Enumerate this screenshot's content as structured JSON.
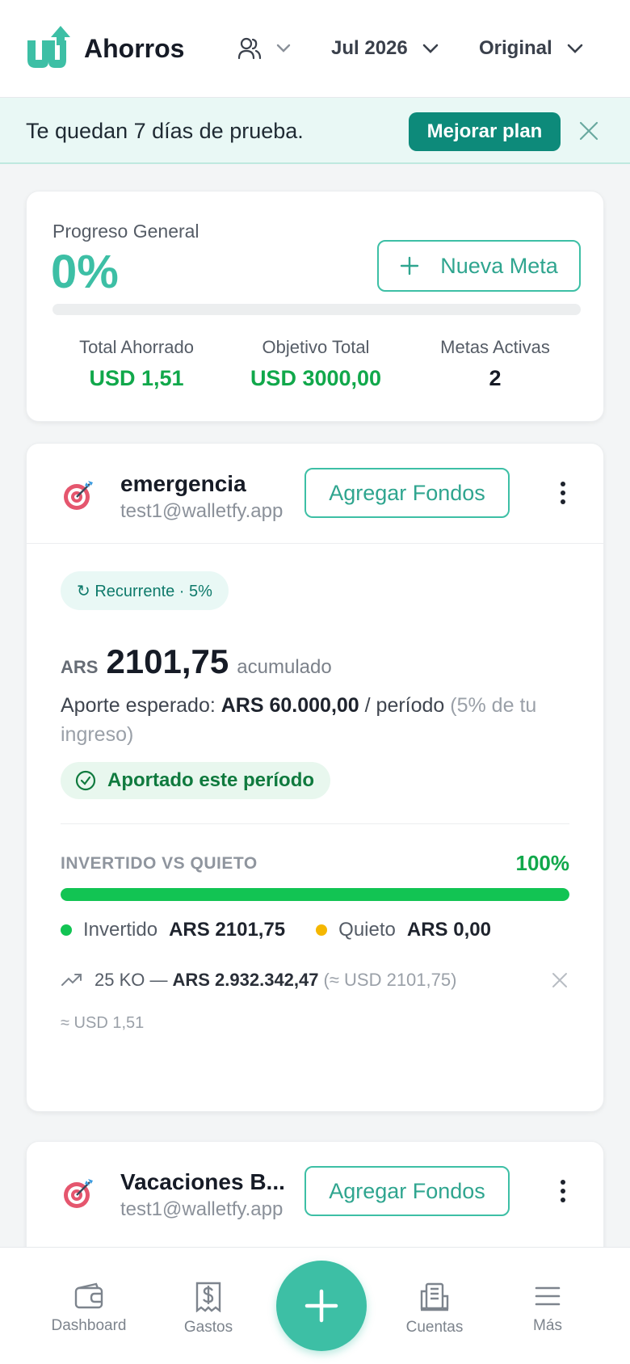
{
  "header": {
    "brand": "Ahorros",
    "month": "Jul 2026",
    "currency_mode": "Original"
  },
  "banner": {
    "text": "Te quedan 7 días de prueba.",
    "button": "Mejorar plan"
  },
  "summary": {
    "label": "Progreso General",
    "percent": "0%",
    "progress_fraction": 0,
    "new_goal_button": "Nueva Meta",
    "stats": [
      {
        "label": "Total Ahorrado",
        "value": "USD 1,51"
      },
      {
        "label": "Objetivo Total",
        "value": "USD 3000,00"
      },
      {
        "label": "Metas Activas",
        "value": "2"
      }
    ]
  },
  "goals": [
    {
      "name": "emergencia",
      "owner": "test1@walletfy.app",
      "add_funds": "Agregar Fondos",
      "recurring": "↻ Recurrente · 5%",
      "accum_currency": "ARS",
      "accum_amount": "2101,75",
      "accum_label": "acumulado",
      "expected_prefix": "Aporte esperado: ",
      "expected_amount": "ARS 60.000,00",
      "expected_period": " / período ",
      "expected_note": "(5% de tu ingreso)",
      "contributed": "Aportado este período",
      "ivq_label": "INVERTIDO VS QUIETO",
      "ivq_percent": "100%",
      "ivq_fraction": 1,
      "invested_label": "Invertido",
      "invested_value": "ARS 2101,75",
      "idle_label": "Quieto",
      "idle_value": "ARS 0,00",
      "investment_name": "25 KO —",
      "investment_amount": "ARS 2.932.342,47",
      "investment_usd": "(≈ USD 2101,75)",
      "approx_usd": "≈ USD 1,51"
    },
    {
      "name": "Vacaciones B...",
      "owner": "test1@walletfy.app",
      "add_funds": "Agregar Fondos"
    }
  ],
  "nav": [
    {
      "label": "Dashboard"
    },
    {
      "label": "Gastos"
    },
    {
      "label": "Cuentas"
    },
    {
      "label": "Más"
    }
  ],
  "colors": {
    "accent": "#3dbfa5",
    "primary_dark": "#0d8a7a",
    "success": "#11a84b",
    "invested": "#12c453",
    "idle": "#f5b700"
  }
}
